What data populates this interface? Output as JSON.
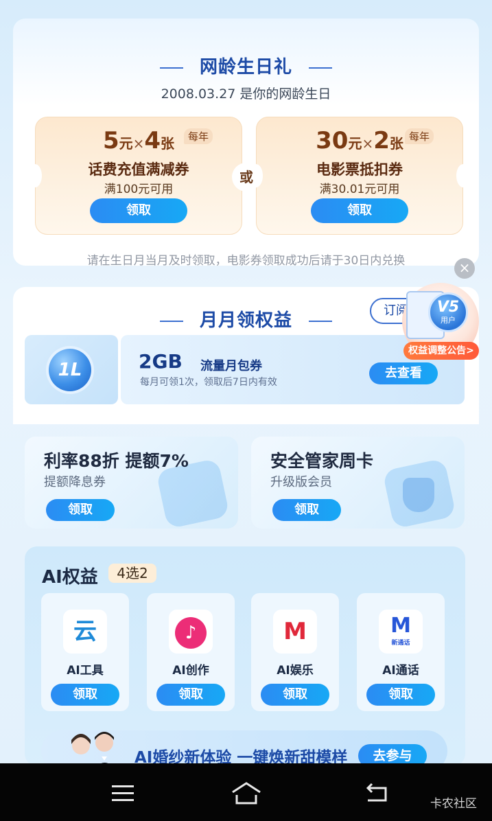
{
  "birthday": {
    "title": "网龄生日礼",
    "subtitle": "2008.03.27 是你的网龄生日",
    "coupon1": {
      "amount": "5",
      "amount_unit": "元",
      "times": "×",
      "count": "4",
      "count_unit": "张",
      "badge": "每年",
      "name": "话费充值满减券",
      "condition": "满100元可用",
      "button": "领取"
    },
    "or_label": "或",
    "coupon2": {
      "amount": "30",
      "amount_unit": "元",
      "times": "×",
      "count": "2",
      "count_unit": "张",
      "badge": "每年",
      "name": "电影票抵扣券",
      "condition": "满30.01元可用",
      "button": "领取"
    },
    "note": "请在生日月当月及时领取，电影券领取成功后请于30日内兑换"
  },
  "close_label": "×",
  "monthly": {
    "title": "月月领权益",
    "subscribe_label": "订阅",
    "data_logo": "1L",
    "data_size": "2GB",
    "data_name": "流量月包券",
    "data_desc": "每月可领1次，领取后7日内有效",
    "data_button": "去查看"
  },
  "v5": {
    "level": "V5",
    "user": "用户",
    "label": "权益调整公告>"
  },
  "promos": [
    {
      "title": "利率88折 提额7%",
      "subtitle": "提额降息券",
      "button": "领取"
    },
    {
      "title": "安全管家周卡",
      "subtitle": "升级版会员",
      "button": "领取"
    }
  ],
  "ai": {
    "title": "AI权益",
    "badge": "4选2",
    "items": [
      {
        "label": "AI工具",
        "icon": "cloud-icon",
        "glyph": "云",
        "button": "领取"
      },
      {
        "label": "AI创作",
        "icon": "music-icon",
        "glyph": "♪",
        "button": "领取"
      },
      {
        "label": "AI娱乐",
        "icon": "video-icon",
        "glyph": "M",
        "button": "领取"
      },
      {
        "label": "AI通话",
        "icon": "call-icon",
        "glyph": "M",
        "sub": "新通话",
        "button": "领取"
      }
    ]
  },
  "wedding": {
    "text": "AI婚纱新体验 一键焕新甜模样",
    "button": "去参与"
  },
  "nav": {
    "watermark": "卡农社区"
  },
  "colors": {
    "accent": "#2b8cf3",
    "title_blue": "#1c4aa6",
    "coupon_brown": "#7a3a12",
    "v5_orange": "#ff6a3c"
  }
}
